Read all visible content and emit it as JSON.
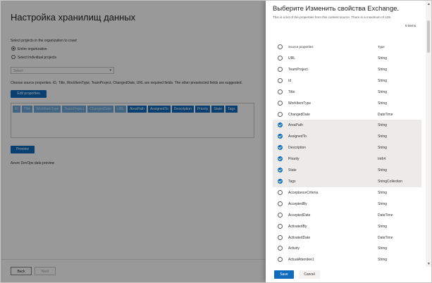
{
  "background": {
    "title": "Настройка хранилищ данных",
    "projects_label": "Select projects in the organization to crawl",
    "radio_entire": "Entire organization",
    "radio_individual": "Select individual projects",
    "select_placeholder": "Select",
    "source_note": "Choose source properties. ID, Title, WorkItemType, TeamProject, ChangedDate, URL are required fields. The other preselected fields are suggested.",
    "edit_properties_label": "Edit properties",
    "chips": [
      {
        "label": "ID",
        "state": "required"
      },
      {
        "label": "Title",
        "state": "required"
      },
      {
        "label": "WorkItemType",
        "state": "required"
      },
      {
        "label": "TeamProject",
        "state": "required"
      },
      {
        "label": "ChangedDate",
        "state": "required"
      },
      {
        "label": "URL",
        "state": "required"
      },
      {
        "label": "AreaPath",
        "state": "suggested"
      },
      {
        "label": "AssignedTo",
        "state": "suggested"
      },
      {
        "label": "Description",
        "state": "suggested"
      },
      {
        "label": "Priority",
        "state": "suggested"
      },
      {
        "label": "State",
        "state": "suggested"
      },
      {
        "label": "Tags",
        "state": "suggested"
      }
    ],
    "preview_label": "Preview",
    "data_preview_label": "Azure DevOps data preview",
    "back_label": "Back",
    "next_label": "Next"
  },
  "panel": {
    "title": "Выберите Изменить свойства Exchange.",
    "description": "This is a list of the properties from this content source. There is a maximum of 128.",
    "items_count": "6 Items",
    "col_source": "Source properties",
    "col_type": "Type",
    "rows": [
      {
        "name": "URL",
        "type": "String",
        "selected": false
      },
      {
        "name": "TeamProject",
        "type": "String",
        "selected": false
      },
      {
        "name": "Id",
        "type": "String",
        "selected": false
      },
      {
        "name": "Title",
        "type": "String",
        "selected": false
      },
      {
        "name": "WorkItemType",
        "type": "String",
        "selected": false
      },
      {
        "name": "ChangedDate",
        "type": "DateTime",
        "selected": false
      },
      {
        "name": "AreaPath",
        "type": "String",
        "selected": true
      },
      {
        "name": "AssignedTo",
        "type": "String",
        "selected": true
      },
      {
        "name": "Description",
        "type": "String",
        "selected": true
      },
      {
        "name": "Priority",
        "type": "Int64",
        "selected": true
      },
      {
        "name": "State",
        "type": "String",
        "selected": true
      },
      {
        "name": "Tags",
        "type": "StringCollection",
        "selected": true
      },
      {
        "name": "AcceptanceCriteria",
        "type": "String",
        "selected": false
      },
      {
        "name": "AcceptedBy",
        "type": "String",
        "selected": false
      },
      {
        "name": "AcceptedDate",
        "type": "DateTime",
        "selected": false
      },
      {
        "name": "ActivatedBy",
        "type": "String",
        "selected": false
      },
      {
        "name": "ActivatedDate",
        "type": "DateTime",
        "selected": false
      },
      {
        "name": "Activity",
        "type": "String",
        "selected": false
      },
      {
        "name": "ActualAttendee1",
        "type": "String",
        "selected": false
      }
    ],
    "save_label": "Save",
    "cancel_label": "Cancel"
  },
  "colors": {
    "accent": "#0f6cbd",
    "selected_row": "#edebe9",
    "overlay": "rgba(0,0,0,0.40)"
  }
}
